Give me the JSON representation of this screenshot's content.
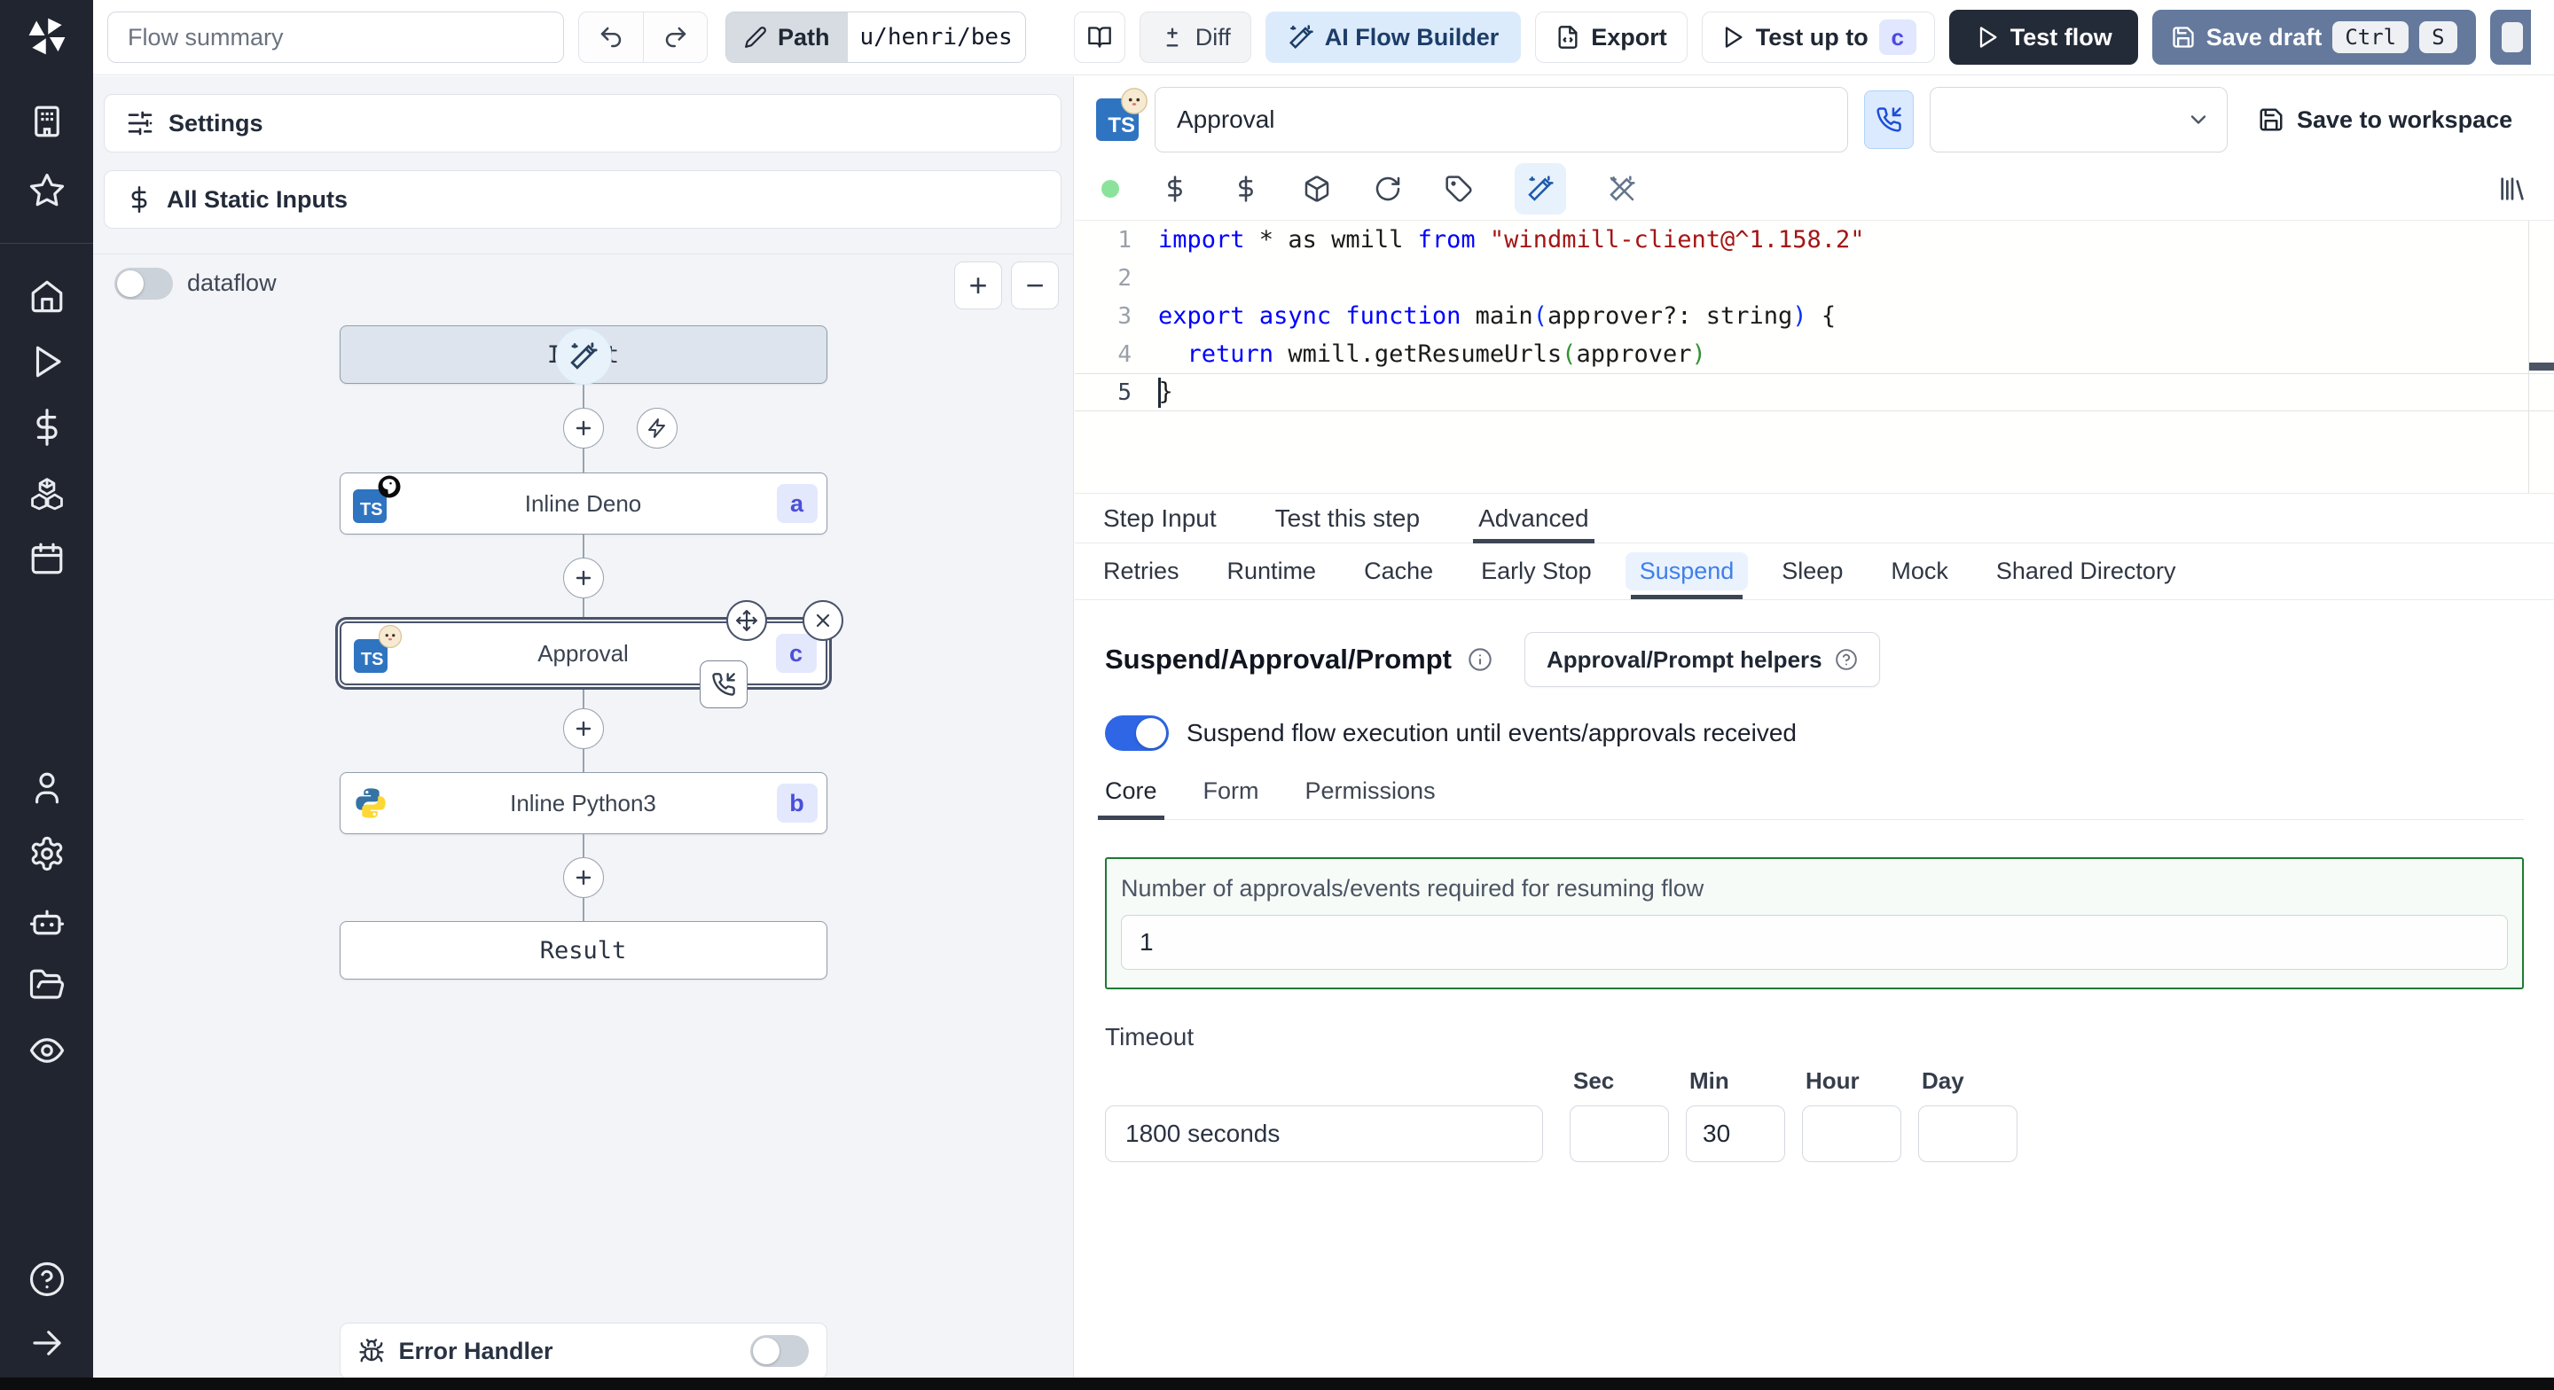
{
  "topbar": {
    "flow_summary_placeholder": "Flow summary",
    "path_label": "Path",
    "path_value": "u/henri/bes",
    "diff_label": "Diff",
    "ai_flow_builder_label": "AI Flow Builder",
    "export_label": "Export",
    "test_up_to_label": "Test up to",
    "test_up_to_badge": "c",
    "test_flow_label": "Test flow",
    "save_draft_label": "Save draft",
    "save_draft_keys": [
      "Ctrl",
      "S"
    ]
  },
  "sidebar": {
    "icons": [
      "windmill-logo",
      "building",
      "star",
      "home",
      "runs-play",
      "variables-dollar",
      "resources-boxes",
      "schedules-calendar",
      "user",
      "settings-gear",
      "workers-bot",
      "folders",
      "audit-eye",
      "help-circle",
      "expand-arrow-right"
    ]
  },
  "flow_panel": {
    "settings_label": "Settings",
    "static_inputs_label": "All Static Inputs",
    "dataflow_label": "dataflow",
    "zoom_in": "+",
    "zoom_out": "−",
    "input_node": "Input",
    "result_node": "Result",
    "steps": [
      {
        "label": "Inline Deno",
        "badge": "a",
        "icon": "typescript-deno",
        "selected": false
      },
      {
        "label": "Approval",
        "badge": "c",
        "icon": "typescript-bun",
        "selected": true
      },
      {
        "label": "Inline Python3",
        "badge": "b",
        "icon": "python",
        "selected": false
      }
    ],
    "error_handler_label": "Error Handler"
  },
  "step_editor": {
    "title_value": "Approval",
    "save_to_workspace_label": "Save to workspace",
    "language_chip": "TS",
    "active_line": 5,
    "lines": [
      [
        {
          "c": "kw",
          "t": "import"
        },
        {
          "c": "pl",
          "t": " * as wmill "
        },
        {
          "c": "kw",
          "t": "from"
        },
        {
          "c": "pl",
          "t": " "
        },
        {
          "c": "str",
          "t": "\"windmill-client@^1.158.2\""
        }
      ],
      [],
      [
        {
          "c": "kw",
          "t": "export"
        },
        {
          "c": "pl",
          "t": " "
        },
        {
          "c": "kw",
          "t": "async"
        },
        {
          "c": "pl",
          "t": " "
        },
        {
          "c": "kw",
          "t": "function"
        },
        {
          "c": "pl",
          "t": " main"
        },
        {
          "c": "brkb",
          "t": "("
        },
        {
          "c": "pl",
          "t": "approver?: string"
        },
        {
          "c": "brkb",
          "t": ")"
        },
        {
          "c": "pl",
          "t": " {"
        }
      ],
      [
        {
          "c": "pl",
          "t": "  "
        },
        {
          "c": "kw",
          "t": "return"
        },
        {
          "c": "pl",
          "t": " wmill.getResumeUrls"
        },
        {
          "c": "brkg",
          "t": "("
        },
        {
          "c": "pl",
          "t": "approver"
        },
        {
          "c": "brkg",
          "t": ")"
        }
      ],
      [
        {
          "c": "pl",
          "t": "}"
        }
      ]
    ]
  },
  "tabs": {
    "items": [
      "Step Input",
      "Test this step",
      "Advanced"
    ],
    "active": "Advanced"
  },
  "advanced_tabs": {
    "items": [
      "Retries",
      "Runtime",
      "Cache",
      "Early Stop",
      "Suspend",
      "Sleep",
      "Mock",
      "Shared Directory"
    ],
    "active": "Suspend"
  },
  "suspend": {
    "heading": "Suspend/Approval/Prompt",
    "helpers_button_label": "Approval/Prompt helpers",
    "toggle_label": "Suspend flow execution until events/approvals received",
    "toggle_on": true,
    "sub_tabs": [
      "Core",
      "Form",
      "Permissions"
    ],
    "sub_tabs_active": "Core",
    "approvals_label": "Number of approvals/events required for resuming flow",
    "approvals_value": "1",
    "timeout_label": "Timeout",
    "timeout_display_value": "1800 seconds",
    "units": [
      {
        "label": "Sec",
        "value": ""
      },
      {
        "label": "Min",
        "value": "30"
      },
      {
        "label": "Hour",
        "value": ""
      },
      {
        "label": "Day",
        "value": ""
      }
    ]
  },
  "colors": {
    "sidebar_bg": "#20252f",
    "accent_blue": "#2e66e5",
    "ai_button_bg": "#dcebfb",
    "save_draft_bg": "#64799c",
    "dark_button_bg": "#242b38",
    "badge_indigo_bg": "#e0e7ff",
    "badge_indigo_text": "#4f46e5",
    "suspend_green_border": "#1d7a35",
    "keyword_blue": "#0000ff",
    "string_red": "#a31515"
  }
}
